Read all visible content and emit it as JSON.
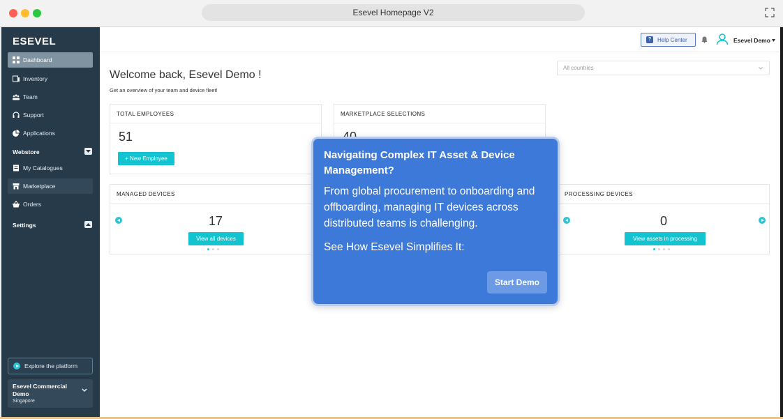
{
  "window": {
    "title": "Esevel Homepage V2"
  },
  "sidebar": {
    "brand": "ESEVEL",
    "items": [
      {
        "label": "Dashboard",
        "icon": "dashboard-icon"
      },
      {
        "label": "Inventory",
        "icon": "inventory-icon"
      },
      {
        "label": "Team",
        "icon": "team-icon"
      },
      {
        "label": "Support",
        "icon": "headset-icon"
      },
      {
        "label": "Applications",
        "icon": "pie-chart-icon"
      }
    ],
    "webstore": {
      "label": "Webstore",
      "items": [
        {
          "label": "My Catalogues",
          "icon": "catalogue-icon"
        },
        {
          "label": "Marketplace",
          "icon": "store-icon"
        },
        {
          "label": "Orders",
          "icon": "basket-icon"
        }
      ]
    },
    "settings_label": "Settings",
    "explore_label": "Explore the platform",
    "account": {
      "name": "Esevel Commercial Demo",
      "location": "Singapore"
    }
  },
  "header": {
    "help_label": "Help Center",
    "user_name": "Esevel Demo"
  },
  "main": {
    "welcome": "Welcome back, Esevel Demo !",
    "subtitle": "Get an overview of your team and device fleet!",
    "country_placeholder": "All countries",
    "cards": {
      "employees": {
        "title": "TOTAL EMPLOYEES",
        "value": "51",
        "button": "+ New Employee"
      },
      "marketplace": {
        "title": "MARKETPLACE SELECTIONS",
        "value": "40"
      },
      "managed": {
        "title": "MANAGED DEVICES",
        "value": "17",
        "button": "View all devices"
      },
      "processing": {
        "title": "PROCESSING DEVICES",
        "value": "0",
        "button": "View assets in processing"
      }
    }
  },
  "popover": {
    "title": "Navigating Complex IT Asset & Device Management?",
    "body": "From global procurement to onboarding and offboarding, managing IT devices across distributed teams is challenging.",
    "cta": "See How Esevel Simplifies It:",
    "button": "Start Demo"
  },
  "colors": {
    "sidebar_bg": "#263a4a",
    "accent_teal": "#13c3cf",
    "popover_blue": "#3d79d9"
  }
}
